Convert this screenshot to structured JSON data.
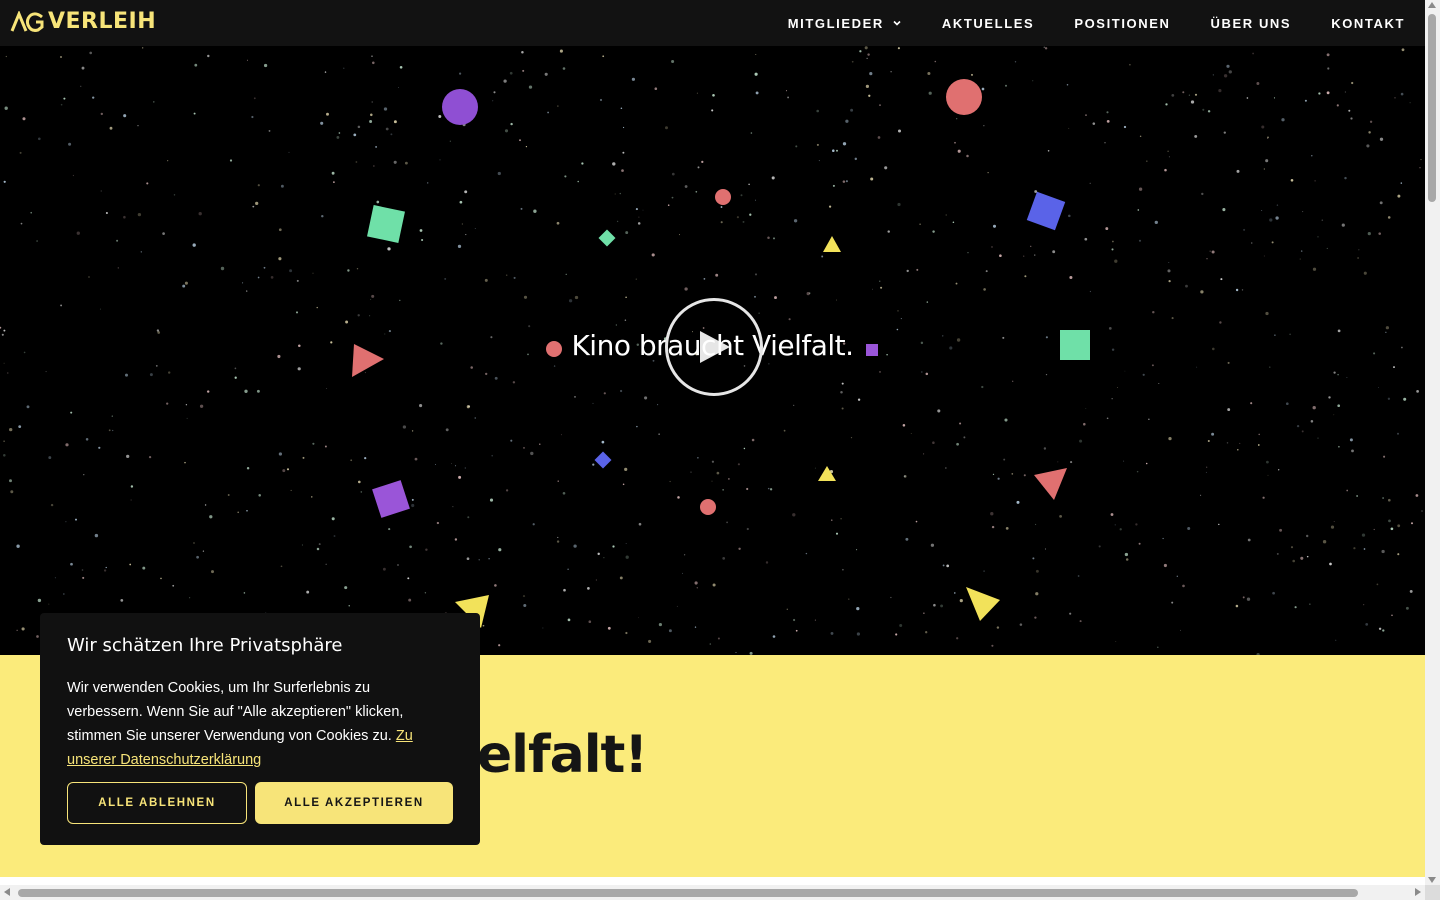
{
  "header": {
    "logo_text": "VERLEIH",
    "logo_mark": "AG",
    "nav": [
      {
        "label": "MITGLIEDER",
        "has_dropdown": true
      },
      {
        "label": "AKTUELLES"
      },
      {
        "label": "POSITIONEN"
      },
      {
        "label": "ÜBER UNS"
      },
      {
        "label": "KONTAKT"
      }
    ]
  },
  "hero": {
    "title": "Kino braucht Vielfalt.",
    "play_icon": "play-icon"
  },
  "section": {
    "heading": "Kino braucht Vielfalt!"
  },
  "cookie": {
    "title": "Wir schätzen Ihre Privatsphäre",
    "text": "Wir verwenden Cookies, um Ihr Surferlebnis zu verbessern. Wenn Sie auf \"Alle akzeptieren\" klicken, stimmen Sie unserer Verwendung von Cookies zu.",
    "link": "Zu unserer Datenschutzerklärung",
    "reject_label": "ALLE ABLEHNEN",
    "accept_label": "ALLE AKZEPTIEREN"
  },
  "colors": {
    "accent": "#f7e479",
    "header_bg": "#121212",
    "yellow_section": "#fbeb7b",
    "cookie_bg": "#111111"
  }
}
